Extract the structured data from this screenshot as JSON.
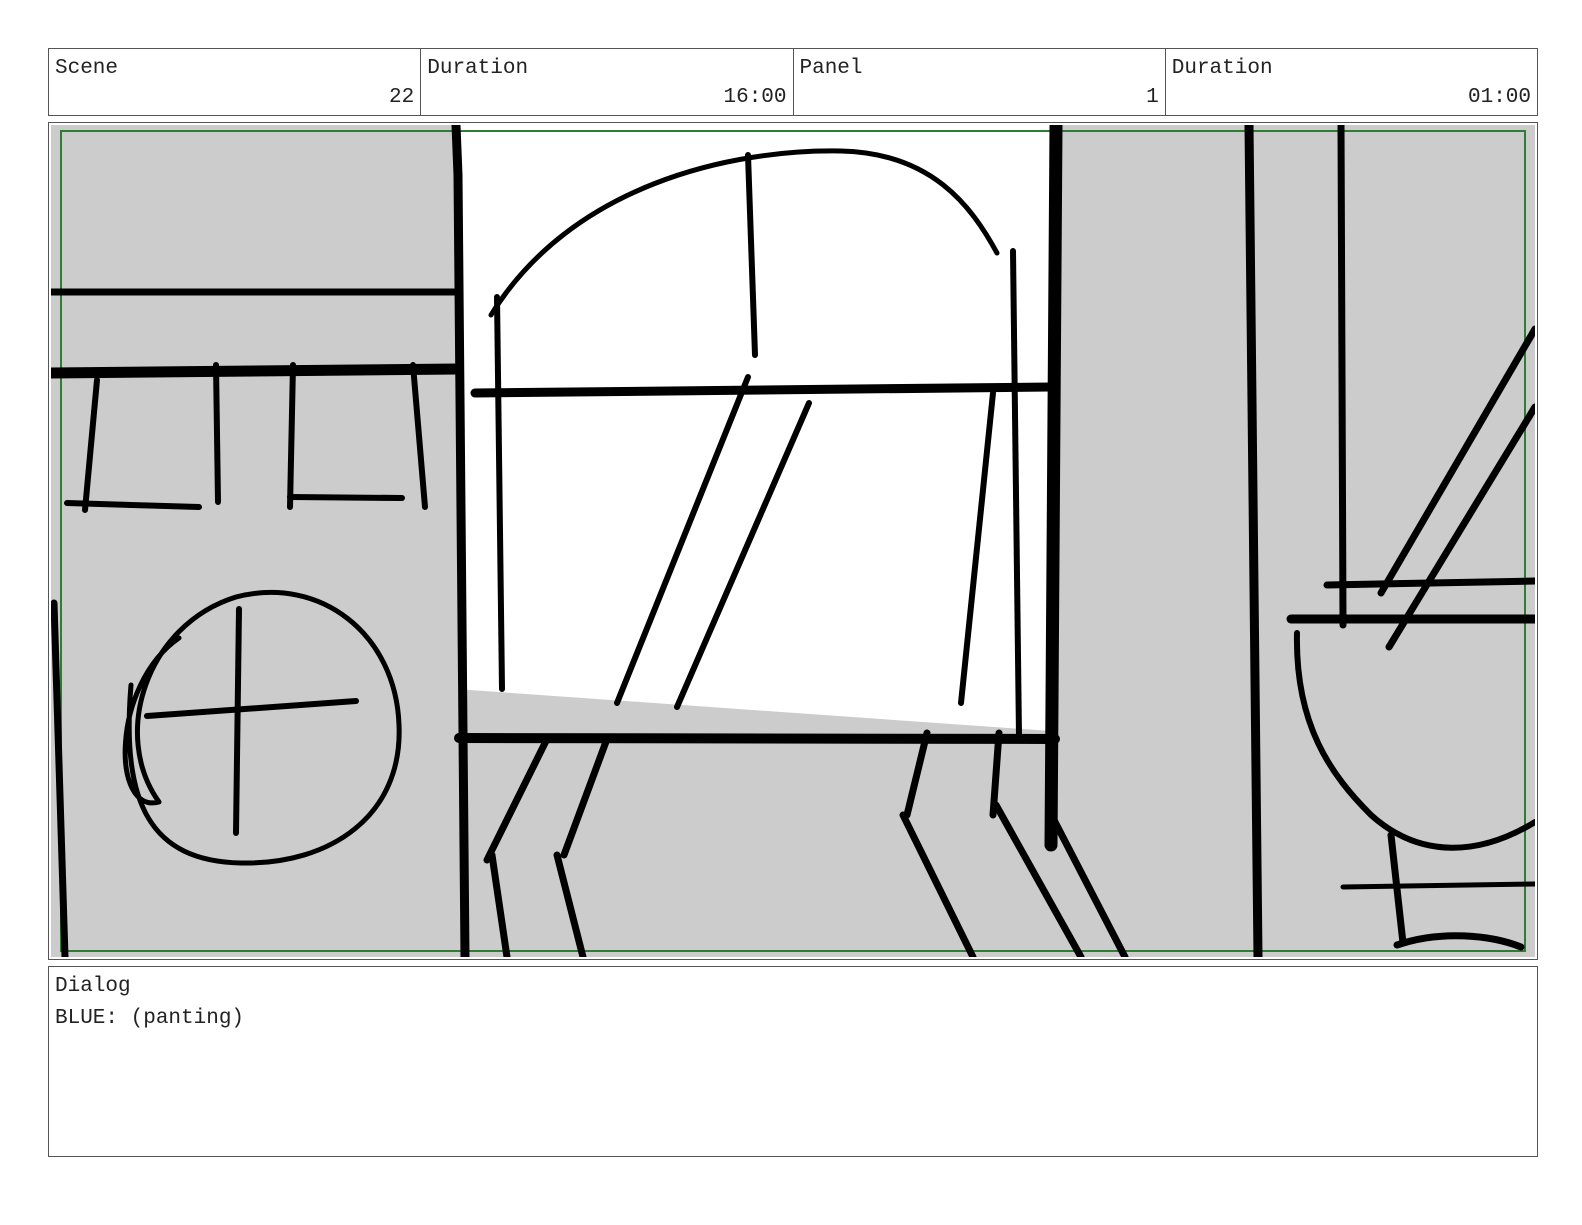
{
  "header": {
    "scene_label": "Scene",
    "scene_value": "22",
    "scene_duration_label": "Duration",
    "scene_duration_value": "16:00",
    "panel_label": "Panel",
    "panel_value": "1",
    "panel_duration_label": "Duration",
    "panel_duration_value": "01:00"
  },
  "dialog": {
    "label": "Dialog",
    "text": "BLUE: (panting)"
  },
  "colors": {
    "fill_gray": "#cccccc",
    "ink": "#000000",
    "safe_frame": "#2e7d32",
    "border": "#555555"
  }
}
